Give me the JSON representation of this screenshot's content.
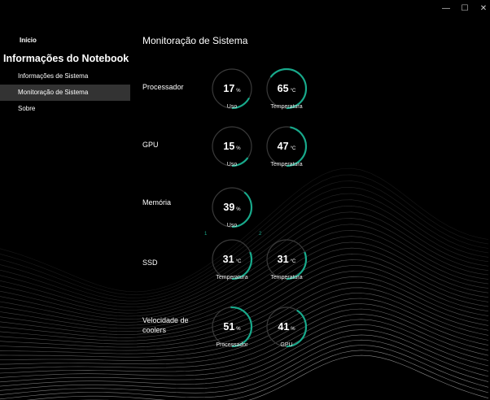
{
  "window_controls": {
    "minimize": "—",
    "maximize": "☐",
    "close": "✕"
  },
  "sidebar": {
    "home_label": "Início",
    "app_title": "Informações do Notebook",
    "items": [
      {
        "label": "Informações de Sistema",
        "active": false
      },
      {
        "label": "Monitoração de Sistema",
        "active": true
      },
      {
        "label": "Sobre",
        "active": false
      }
    ]
  },
  "main": {
    "title": "Monitoração de Sistema",
    "accent": "#18a98b",
    "ring_track": "#3a3a3a",
    "rows": [
      {
        "label": "Processador",
        "gauges": [
          {
            "value": "17",
            "unit": "%",
            "caption": "Uso",
            "fill": 0.17
          },
          {
            "value": "65",
            "unit": "°C",
            "caption": "Temperatura",
            "fill": 0.65
          }
        ]
      },
      {
        "label": "GPU",
        "gauges": [
          {
            "value": "15",
            "unit": "%",
            "caption": "Uso",
            "fill": 0.15
          },
          {
            "value": "47",
            "unit": "°C",
            "caption": "Temperatura",
            "fill": 0.47
          }
        ]
      },
      {
        "label": "Memória",
        "gauges": [
          {
            "value": "39",
            "unit": "%",
            "caption": "Uso",
            "fill": 0.39
          }
        ]
      },
      {
        "label": "SSD",
        "gauges": [
          {
            "index": "1",
            "value": "31",
            "unit": "°C",
            "caption": "Temperatura",
            "fill": 0.31
          },
          {
            "index": "2",
            "value": "31",
            "unit": "°C",
            "caption": "Temperatura",
            "fill": 0.31
          }
        ]
      },
      {
        "label": "Velocidade de\ncoolers",
        "gauges": [
          {
            "value": "51",
            "unit": "%",
            "caption": "Processador",
            "fill": 0.51
          },
          {
            "value": "41",
            "unit": "%",
            "caption": "GPU",
            "fill": 0.41
          }
        ]
      }
    ]
  }
}
